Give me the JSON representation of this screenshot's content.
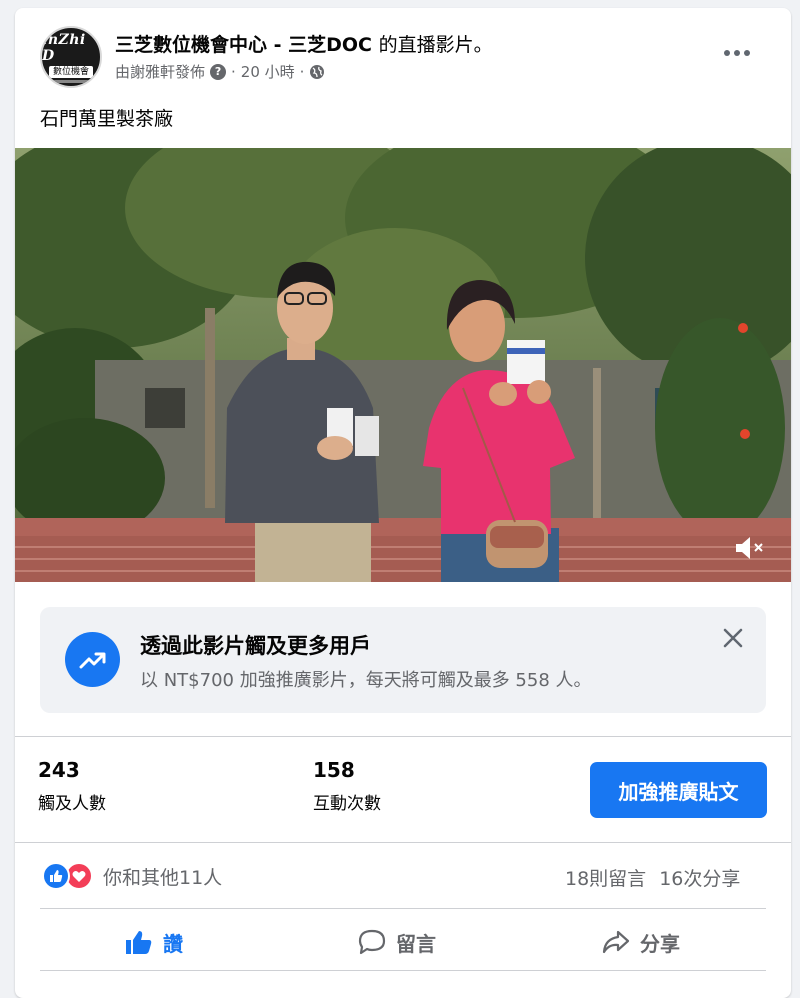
{
  "header": {
    "page_name": "三芝數位機會中心 - 三芝DOC",
    "title_suffix": "的直播影片。",
    "author": "由謝雅軒發佈",
    "time": "20 小時",
    "avatar_logo_text": "inZhi D",
    "avatar_logo_sub": "數位機會"
  },
  "post": {
    "text": "石門萬里製茶廠"
  },
  "boost_banner": {
    "title": "透過此影片觸及更多用戶",
    "description": "以 NT$700 加強推廣影片，每天將可觸及最多 558 人。"
  },
  "stats": {
    "reach_count": "243",
    "reach_label": "觸及人數",
    "engagement_count": "158",
    "engagement_label": "互動次數",
    "promote_button": "加強推廣貼文"
  },
  "reactions": {
    "text": "你和其他11人",
    "comments": "18則留言",
    "shares": "16次分享"
  },
  "actions": {
    "like": "讚",
    "comment": "留言",
    "share": "分享"
  },
  "icons": {
    "more": "more-horizontal-icon",
    "help": "question-icon",
    "audience": "globe-icon",
    "mute": "speaker-muted-icon",
    "boost": "trending-up-icon",
    "close": "close-icon",
    "like": "thumbs-up-icon",
    "love": "heart-icon",
    "comment": "speech-bubble-icon",
    "share": "share-arrow-icon"
  },
  "colors": {
    "accent": "#1877f2",
    "love": "#f33e58",
    "secondary_text": "#65676b"
  }
}
